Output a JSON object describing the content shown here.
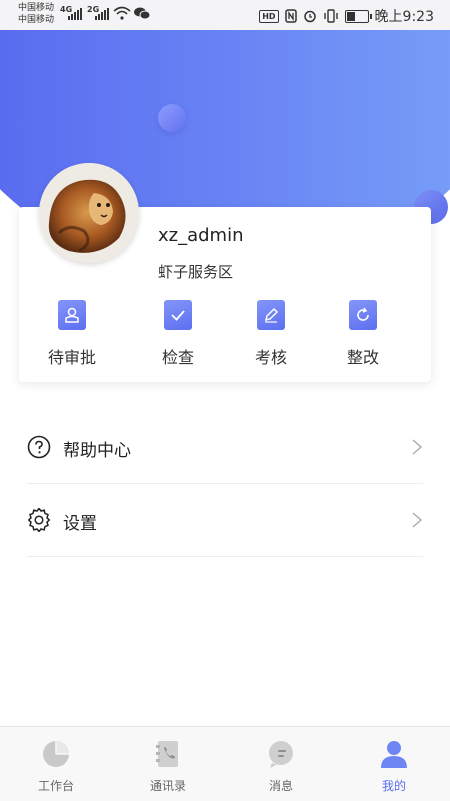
{
  "status_bar": {
    "carrier1": "中国移动",
    "carrier2": "中国移动",
    "net1": "4G",
    "net2": "2G",
    "hd": "HD",
    "time": "晚上9:23"
  },
  "profile": {
    "username": "xz_admin",
    "organization": "虾子服务区"
  },
  "actions": [
    {
      "label": "待审批",
      "icon": "user-approval-icon"
    },
    {
      "label": "检查",
      "icon": "check-icon"
    },
    {
      "label": "考核",
      "icon": "edit-icon"
    },
    {
      "label": "整改",
      "icon": "refresh-icon"
    }
  ],
  "menu": [
    {
      "label": "帮助中心",
      "icon": "help-icon"
    },
    {
      "label": "设置",
      "icon": "gear-icon"
    }
  ],
  "bottom_nav": {
    "items": [
      {
        "label": "工作台",
        "icon": "pie-chart-icon"
      },
      {
        "label": "通讯录",
        "icon": "contacts-icon"
      },
      {
        "label": "消息",
        "icon": "message-icon"
      },
      {
        "label": "我的",
        "icon": "user-icon"
      }
    ],
    "active_index": 3
  },
  "colors": {
    "accent": "#5a6ff0",
    "gradient_start": "#5566ef",
    "gradient_end": "#7aa3f8"
  }
}
